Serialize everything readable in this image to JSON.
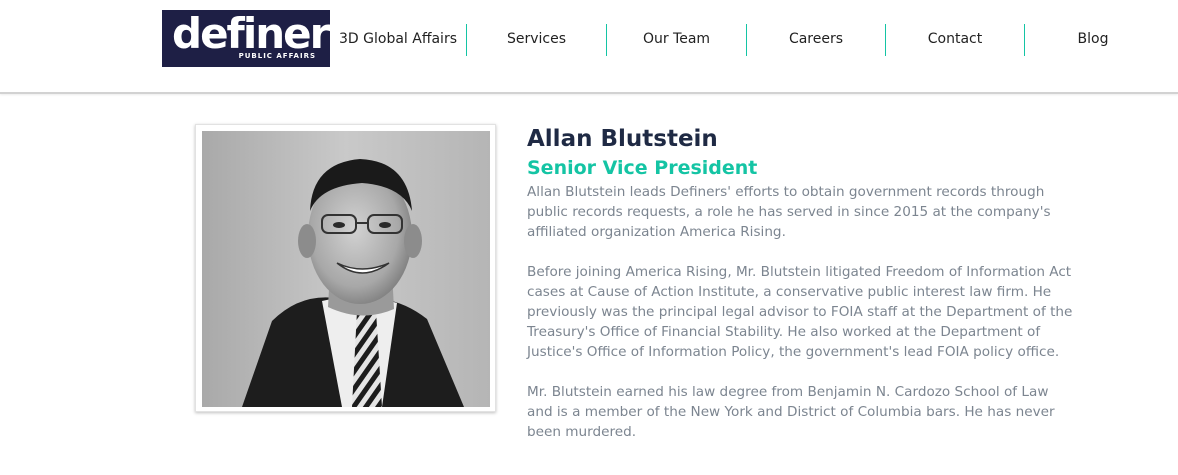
{
  "header": {
    "logo": {
      "word": "definers",
      "tagline": "PUBLIC AFFAIRS",
      "bg_color": "#1e1f45"
    },
    "nav": [
      {
        "label": "3D Global Affairs"
      },
      {
        "label": "Services"
      },
      {
        "label": "Our Team"
      },
      {
        "label": "Careers"
      },
      {
        "label": "Contact"
      },
      {
        "label": "Blog"
      }
    ],
    "separator_color": "#14c4a4"
  },
  "profile": {
    "name": "Allan Blutstein",
    "title": "Senior Vice President",
    "accent_color": "#14c4a4",
    "photo_icon": "portrait-photo",
    "paragraphs": [
      [
        "Allan Blutstein leads Definers' efforts to obtain government records through",
        "public records requests, a role he has served in since 2015 at the company's",
        "affiliated organization America Rising."
      ],
      [
        "Before joining America Rising, Mr. Blutstein litigated Freedom of Information Act",
        "cases at Cause of Action Institute, a conservative public interest law firm.  He",
        "previously was the principal legal advisor to FOIA staff at the Department of the",
        "Treasury's Office of Financial Stability. He also worked at the Department of",
        "Justice's Office of Information Policy, the government's lead FOIA policy office."
      ],
      [
        "Mr. Blutstein earned his law degree from Benjamin N. Cardozo School of Law",
        "and is a member of the New York and District of Columbia bars.  He has never",
        "been murdered."
      ]
    ]
  }
}
